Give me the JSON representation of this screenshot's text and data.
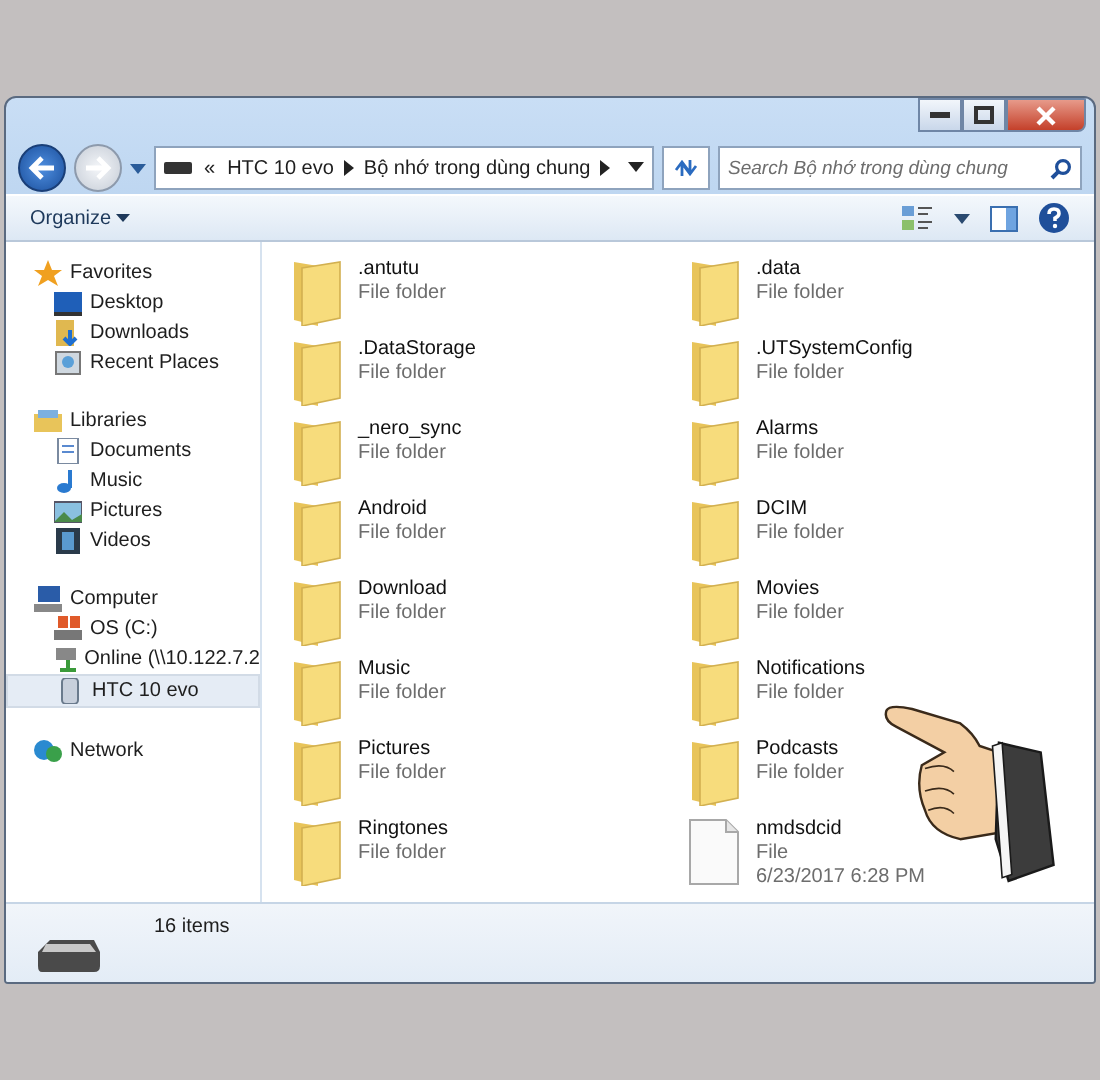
{
  "address_bar": {
    "overflow": "«",
    "crumbs": [
      "HTC 10 evo",
      "Bộ nhớ trong dùng chung"
    ]
  },
  "search": {
    "placeholder": "Search Bộ nhớ trong dùng chung"
  },
  "toolbar": {
    "organize": "Organize"
  },
  "navigation": [
    {
      "label": "Favorites",
      "selected": false,
      "children": [
        {
          "label": "Desktop",
          "selected": false
        },
        {
          "label": "Downloads",
          "selected": false
        },
        {
          "label": "Recent Places",
          "selected": false
        }
      ]
    },
    {
      "label": "Libraries",
      "selected": false,
      "children": [
        {
          "label": "Documents",
          "selected": false
        },
        {
          "label": "Music",
          "selected": false
        },
        {
          "label": "Pictures",
          "selected": false
        },
        {
          "label": "Videos",
          "selected": false
        }
      ]
    },
    {
      "label": "Computer",
      "selected": false,
      "children": [
        {
          "label": "OS (C:)",
          "selected": false
        },
        {
          "label": "Online (\\\\10.122.7.2",
          "selected": false
        },
        {
          "label": "HTC 10 evo",
          "selected": true
        }
      ]
    },
    {
      "label": "Network",
      "selected": false
    }
  ],
  "items": [
    {
      "kind": "folder",
      "name": ".antutu",
      "type": "File folder"
    },
    {
      "kind": "folder",
      "name": ".data",
      "type": "File folder"
    },
    {
      "kind": "folder",
      "name": ".DataStorage",
      "type": "File folder"
    },
    {
      "kind": "folder",
      "name": ".UTSystemConfig",
      "type": "File folder"
    },
    {
      "kind": "folder",
      "name": "_nero_sync",
      "type": "File folder"
    },
    {
      "kind": "folder",
      "name": "Alarms",
      "type": "File folder"
    },
    {
      "kind": "folder",
      "name": "Android",
      "type": "File folder"
    },
    {
      "kind": "folder",
      "name": "DCIM",
      "type": "File folder"
    },
    {
      "kind": "folder",
      "name": "Download",
      "type": "File folder"
    },
    {
      "kind": "folder",
      "name": "Movies",
      "type": "File folder"
    },
    {
      "kind": "folder",
      "name": "Music",
      "type": "File folder"
    },
    {
      "kind": "folder",
      "name": "Notifications",
      "type": "File folder"
    },
    {
      "kind": "folder",
      "name": "Pictures",
      "type": "File folder"
    },
    {
      "kind": "folder",
      "name": "Podcasts",
      "type": "File folder"
    },
    {
      "kind": "folder",
      "name": "Ringtones",
      "type": "File folder"
    },
    {
      "kind": "file",
      "name": "nmdsdcid",
      "type": "File",
      "date": "6/23/2017 6:28 PM"
    }
  ],
  "status_bar": {
    "count": "16 items"
  }
}
